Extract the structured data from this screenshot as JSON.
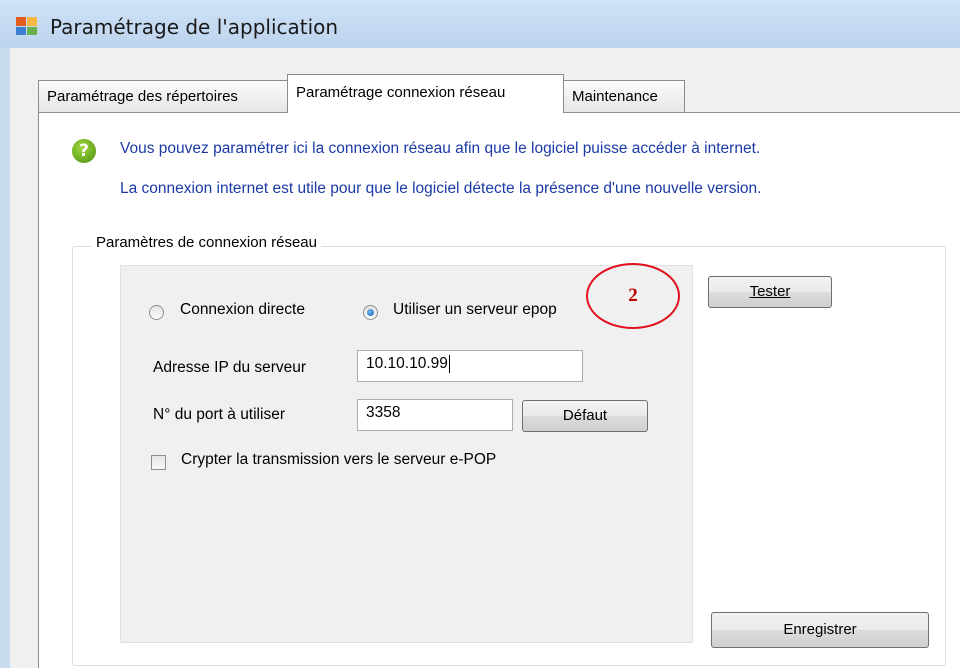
{
  "window": {
    "title": "Paramétrage de l'application"
  },
  "tabs": [
    {
      "label": "Paramétrage des répertoires",
      "active": false
    },
    {
      "label": "Paramétrage connexion réseau",
      "active": true
    },
    {
      "label": "Maintenance",
      "active": false
    }
  ],
  "info": {
    "line1": "Vous pouvez paramétrer ici la connexion réseau afin que le logiciel puisse accéder à internet.",
    "line2": "La connexion internet est utile pour que le logiciel détecte la présence d'une nouvelle version."
  },
  "group": {
    "title": "Paramètres de connexion réseau",
    "radio_direct": "Connexion directe",
    "radio_server": "Utiliser un serveur epop",
    "selected_option": "Utiliser un serveur epop",
    "ip_label": "Adresse IP du serveur",
    "ip_value": "10.10.10.99",
    "port_label": "N° du port à utiliser",
    "port_value": "3358",
    "default_button": "Défaut",
    "encrypt_label": "Crypter la transmission vers le serveur e-POP",
    "encrypt_checked": false
  },
  "buttons": {
    "test": "Tester",
    "save": "Enregistrer"
  },
  "annotation": {
    "label": "2"
  },
  "colors": {
    "info_text": "#1b3aa6",
    "annotation": "#e0101c",
    "titlebar": "#c9dcef"
  }
}
